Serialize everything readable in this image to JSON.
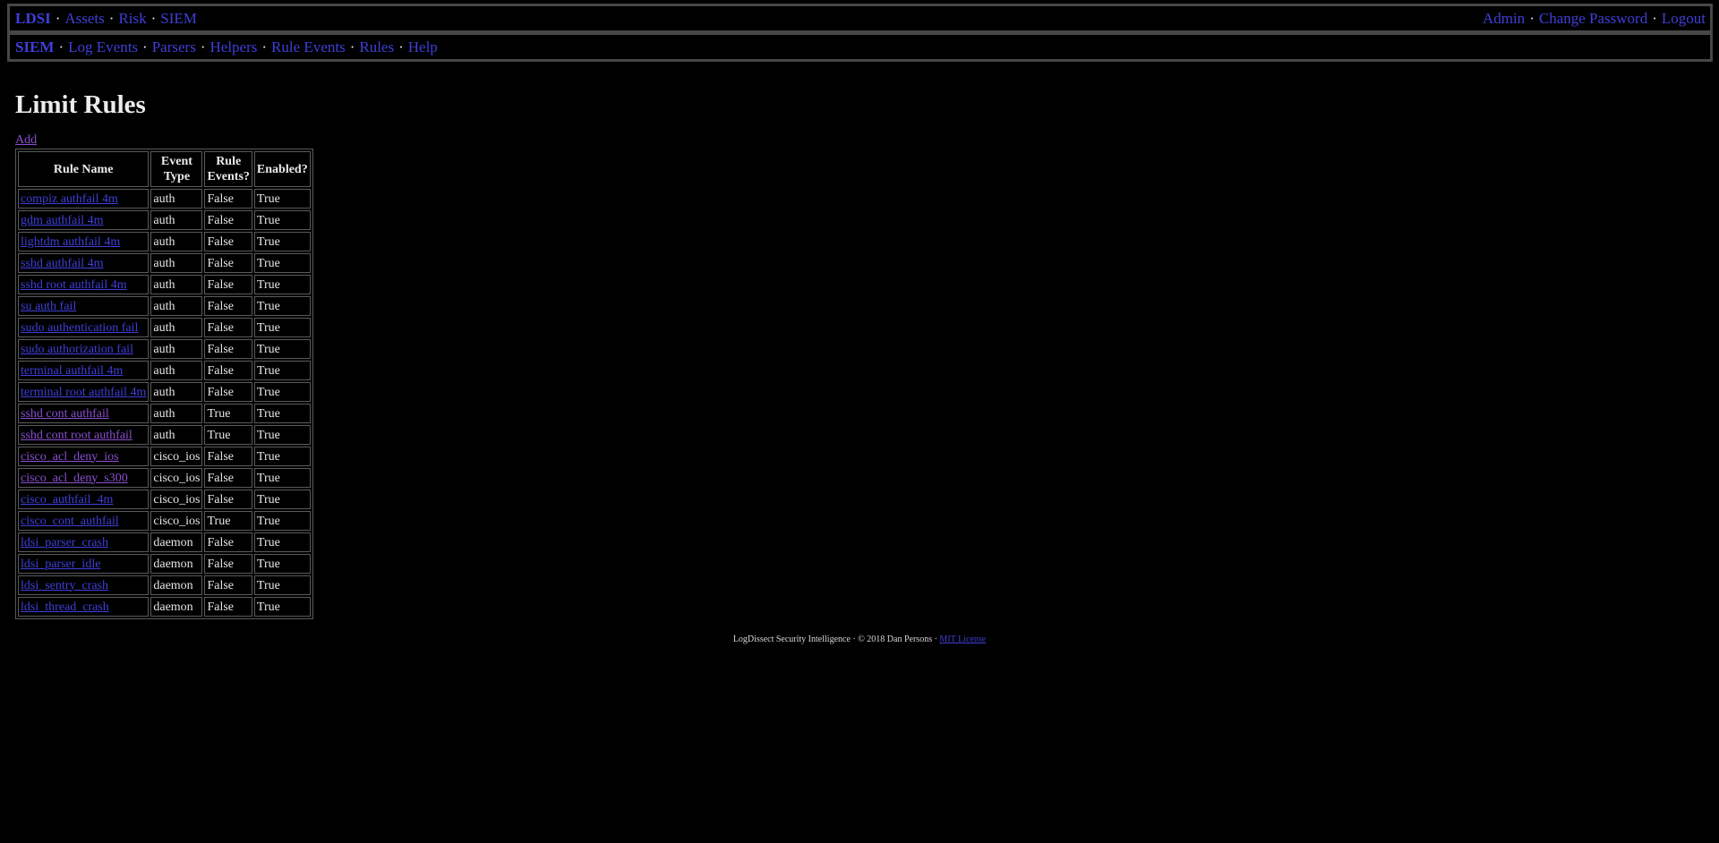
{
  "top_nav": {
    "left": [
      {
        "label": "LDSI",
        "strong": true
      },
      {
        "label": "Assets"
      },
      {
        "label": "Risk"
      },
      {
        "label": "SIEM"
      }
    ],
    "right": [
      {
        "label": "Admin"
      },
      {
        "label": "Change Password"
      },
      {
        "label": "Logout"
      }
    ],
    "separator": "·"
  },
  "sub_nav": {
    "left": [
      {
        "label": "SIEM",
        "strong": true
      },
      {
        "label": "Log Events"
      },
      {
        "label": "Parsers"
      },
      {
        "label": "Helpers"
      },
      {
        "label": "Rule Events"
      },
      {
        "label": "Rules"
      },
      {
        "label": "Help"
      }
    ]
  },
  "page": {
    "title": "Limit Rules",
    "add_label": "Add"
  },
  "table": {
    "headers": {
      "rule_name": "Rule Name",
      "event_type_1": "Event",
      "event_type_2": "Type",
      "rule_events_1": "Rule",
      "rule_events_2": "Events?",
      "enabled": "Enabled?"
    },
    "rows": [
      {
        "name": "compiz authfail 4m",
        "event_type": "auth",
        "rule_events": "False",
        "enabled": "True",
        "visited": false
      },
      {
        "name": "gdm authfail 4m",
        "event_type": "auth",
        "rule_events": "False",
        "enabled": "True",
        "visited": false
      },
      {
        "name": "lightdm authfail 4m",
        "event_type": "auth",
        "rule_events": "False",
        "enabled": "True",
        "visited": false
      },
      {
        "name": "sshd authfail 4m",
        "event_type": "auth",
        "rule_events": "False",
        "enabled": "True",
        "visited": false
      },
      {
        "name": "sshd root authfail 4m",
        "event_type": "auth",
        "rule_events": "False",
        "enabled": "True",
        "visited": false
      },
      {
        "name": "su auth fail",
        "event_type": "auth",
        "rule_events": "False",
        "enabled": "True",
        "visited": false
      },
      {
        "name": "sudo authentication fail",
        "event_type": "auth",
        "rule_events": "False",
        "enabled": "True",
        "visited": false
      },
      {
        "name": "sudo authorization fail",
        "event_type": "auth",
        "rule_events": "False",
        "enabled": "True",
        "visited": false
      },
      {
        "name": "terminal authfail 4m",
        "event_type": "auth",
        "rule_events": "False",
        "enabled": "True",
        "visited": false
      },
      {
        "name": "terminal root authfail 4m",
        "event_type": "auth",
        "rule_events": "False",
        "enabled": "True",
        "visited": false
      },
      {
        "name": "sshd cont authfail",
        "event_type": "auth",
        "rule_events": "True",
        "enabled": "True",
        "visited": true
      },
      {
        "name": "sshd cont root authfail",
        "event_type": "auth",
        "rule_events": "True",
        "enabled": "True",
        "visited": true
      },
      {
        "name": "cisco_acl_deny_ios",
        "event_type": "cisco_ios",
        "rule_events": "False",
        "enabled": "True",
        "visited": true
      },
      {
        "name": "cisco_acl_deny_s300",
        "event_type": "cisco_ios",
        "rule_events": "False",
        "enabled": "True",
        "visited": true
      },
      {
        "name": "cisco_authfail_4m",
        "event_type": "cisco_ios",
        "rule_events": "False",
        "enabled": "True",
        "visited": false
      },
      {
        "name": "cisco_cont_authfail",
        "event_type": "cisco_ios",
        "rule_events": "True",
        "enabled": "True",
        "visited": false
      },
      {
        "name": "ldsi_parser_crash",
        "event_type": "daemon",
        "rule_events": "False",
        "enabled": "True",
        "visited": false
      },
      {
        "name": "ldsi_parser_idle",
        "event_type": "daemon",
        "rule_events": "False",
        "enabled": "True",
        "visited": false
      },
      {
        "name": "ldsi_sentry_crash",
        "event_type": "daemon",
        "rule_events": "False",
        "enabled": "True",
        "visited": false
      },
      {
        "name": "ldsi_thread_crash",
        "event_type": "daemon",
        "rule_events": "False",
        "enabled": "True",
        "visited": false
      }
    ]
  },
  "footer": {
    "text": "LogDissect Security Intelligence · © 2018 Dan Persons · ",
    "license_label": "MIT License"
  },
  "colors": {
    "link": "#3f3fd9",
    "visited_link": "#8a4fcf",
    "background": "#000000",
    "border": "#474747"
  }
}
